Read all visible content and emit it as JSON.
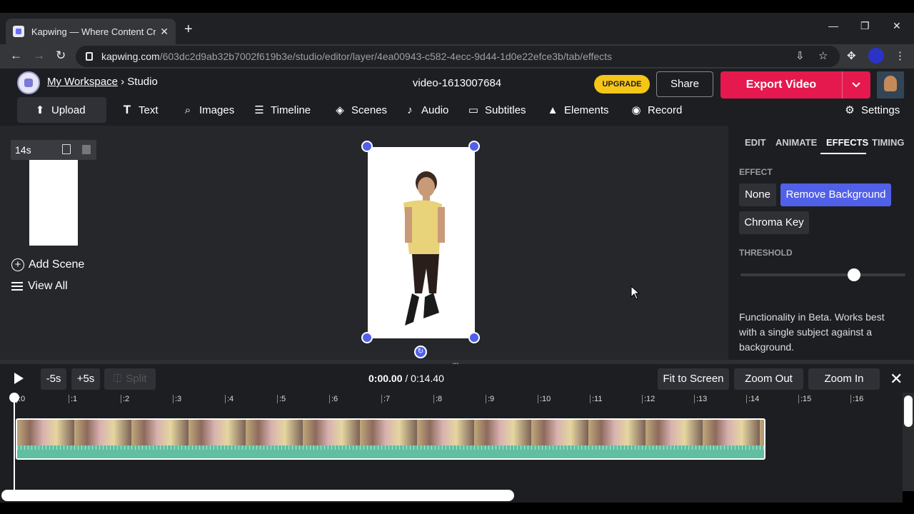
{
  "browser": {
    "tab_title": "Kapwing — Where Content Creat",
    "url_domain": "kapwing.com",
    "url_path": "/603dc2d9ab32b7002f619b3e/studio/editor/layer/4ea00943-c582-4ecc-9d44-1d0e22efce3b/tab/effects"
  },
  "header": {
    "workspace": "My Workspace",
    "separator": "›",
    "section": "Studio",
    "doc_title": "video-1613007684",
    "upgrade_label": "UPGRADE",
    "share_label": "Share",
    "export_label": "Export Video"
  },
  "toolbar": [
    {
      "label": "Upload",
      "icon": "upload-icon"
    },
    {
      "label": "Text",
      "icon": "text-icon"
    },
    {
      "label": "Images",
      "icon": "search-icon"
    },
    {
      "label": "Timeline",
      "icon": "timeline-icon"
    },
    {
      "label": "Scenes",
      "icon": "layers-icon"
    },
    {
      "label": "Audio",
      "icon": "music-note-icon"
    },
    {
      "label": "Subtitles",
      "icon": "subtitles-icon"
    },
    {
      "label": "Elements",
      "icon": "shapes-icon"
    },
    {
      "label": "Record",
      "icon": "record-icon"
    },
    {
      "label": "Settings",
      "icon": "gear-icon"
    }
  ],
  "scenes": {
    "duration": "14s",
    "add_label": "Add Scene",
    "view_all_label": "View All"
  },
  "panel": {
    "tabs": [
      "EDIT",
      "ANIMATE",
      "EFFECTS",
      "TIMING"
    ],
    "active_tab": "EFFECTS",
    "effect_label": "EFFECT",
    "effects": [
      "None",
      "Remove Background",
      "Chroma Key"
    ],
    "selected_effect": "Remove Background",
    "threshold_label": "THRESHOLD",
    "threshold_value": 0.69,
    "note": "Functionality in Beta. Works best with a single subject against a background."
  },
  "timeline": {
    "back_label": "-5s",
    "fwd_label": "+5s",
    "split_label": "Split",
    "current_time": "0:00.00",
    "time_sep": " / ",
    "total_time": "0:14.40",
    "fit_label": "Fit to Screen",
    "zoom_out_label": "Zoom Out",
    "zoom_in_label": "Zoom In",
    "ruler": [
      ":0",
      ":1",
      ":2",
      ":3",
      ":4",
      ":5",
      ":6",
      ":7",
      ":8",
      ":9",
      ":10",
      ":11",
      ":12",
      ":13",
      ":14",
      ":15",
      ":16"
    ]
  },
  "colors": {
    "accent": "#5160e8",
    "export": "#e5194e",
    "upgrade": "#f5c518",
    "waveform": "#5fbfa0"
  }
}
